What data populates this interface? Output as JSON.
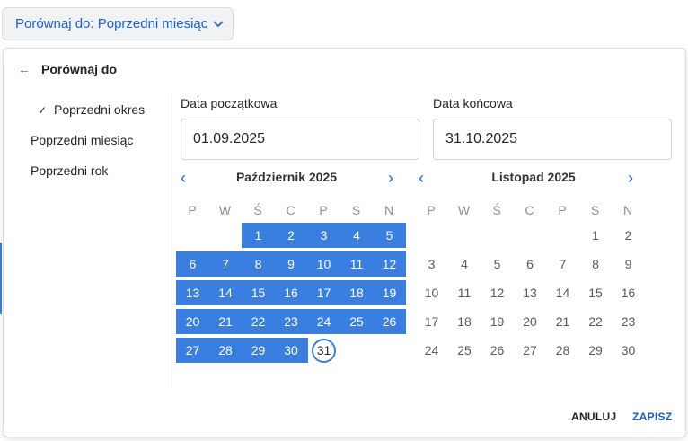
{
  "compare_button": {
    "label": "Porównaj do: Poprzedni miesiąc",
    "chevron": "chevron-down-icon"
  },
  "panel": {
    "back_icon": "←",
    "title": "Porównaj do",
    "options": [
      {
        "label": "Poprzedni okres",
        "checked": true
      },
      {
        "label": "Poprzedni miesiąc",
        "checked": false
      },
      {
        "label": "Poprzedni rok",
        "checked": false
      }
    ],
    "check_glyph": "✓",
    "start_label": "Data początkowa",
    "start_value": "01.09.2025",
    "end_label": "Data końcowa",
    "end_value": "31.10.2025",
    "left_month": "Październik 2025",
    "right_month": "Listopad 2025",
    "prev_glyph": "‹",
    "next_glyph": "›",
    "weekdays": [
      "P",
      "W",
      "Ś",
      "C",
      "P",
      "S",
      "N"
    ],
    "cancel": "ANULUJ",
    "save": "ZAPISZ"
  },
  "colors": {
    "accent": "#3a7fe0",
    "link": "#1a5fd1"
  }
}
